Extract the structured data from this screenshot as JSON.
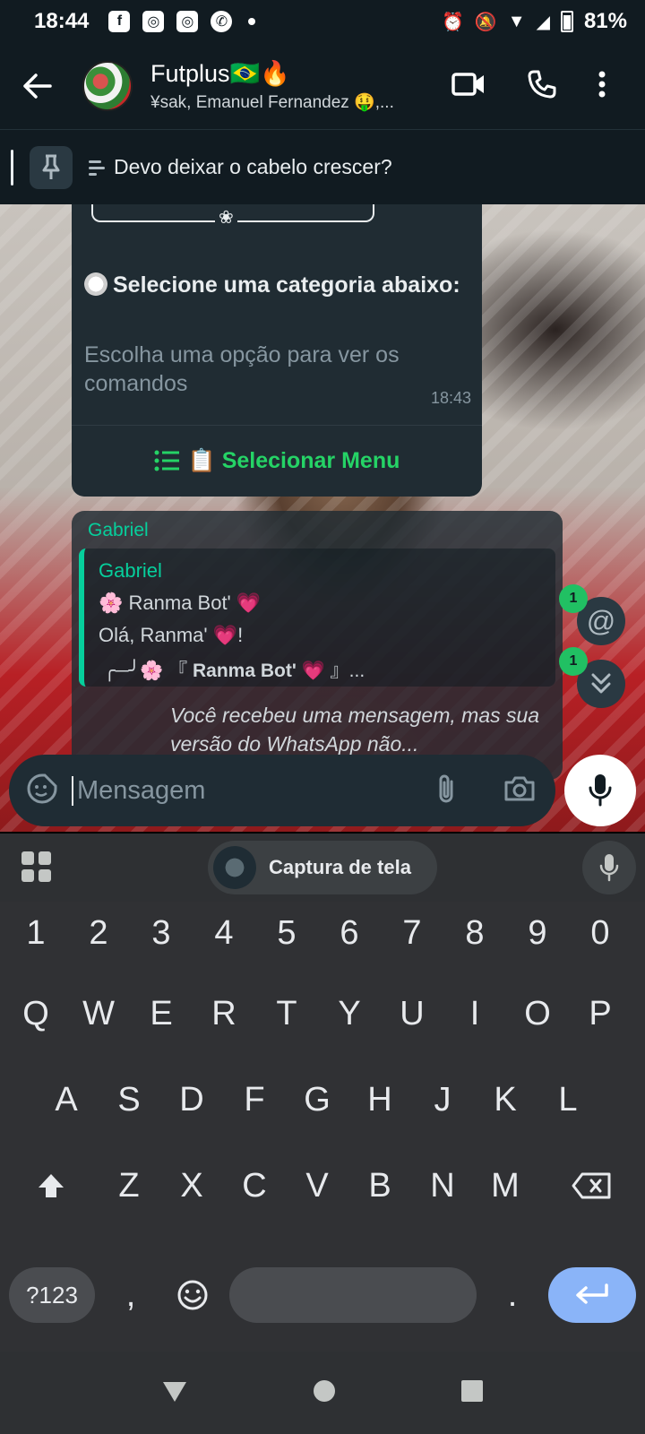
{
  "status_bar": {
    "time": "18:44",
    "battery": "81%",
    "left_icons": [
      "facebook-icon",
      "instagram-icon",
      "instagram-icon",
      "whatsapp-icon"
    ],
    "right_icons": [
      "alarm-icon",
      "mute-icon",
      "wifi-icon",
      "signal-icon",
      "battery-icon"
    ]
  },
  "header": {
    "title": "Futplus🇧🇷🔥",
    "subtitle": "¥sak, Emanuel Fernandez 🤑,..."
  },
  "pinned": {
    "text": "Devo deixar o cabelo crescer?"
  },
  "messages": {
    "menu": {
      "title": "Selecione uma categoria abaixo:",
      "description": "Escolha uma opção para ver os comandos",
      "time": "18:43",
      "button_label": "📋 Selecionar Menu"
    },
    "reply": {
      "sender": "Gabriel",
      "quoted_name": "Gabriel",
      "quoted_line1": "🌸 Ranma Bot' 💗",
      "quoted_line2": "Olá, Ranma' 💗!",
      "quoted_line3_prefix": "╭─╯🌸 『",
      "quoted_line3_bold": "Ranma Bot' 💗",
      "quoted_line3_suffix": "』...",
      "unsupported_text": "Você recebeu uma mensagem, mas sua versão do WhatsApp não..."
    }
  },
  "badges": {
    "mentions": "1",
    "unread": "1"
  },
  "composer": {
    "placeholder": "Mensagem"
  },
  "keyboard": {
    "suggestion_chip": "Captura de tela",
    "number_row": [
      "1",
      "2",
      "3",
      "4",
      "5",
      "6",
      "7",
      "8",
      "9",
      "0"
    ],
    "row1": [
      "Q",
      "W",
      "E",
      "R",
      "T",
      "Y",
      "U",
      "I",
      "O",
      "P"
    ],
    "row2": [
      "A",
      "S",
      "D",
      "F",
      "G",
      "H",
      "J",
      "K",
      "L"
    ],
    "row3": [
      "Z",
      "X",
      "C",
      "V",
      "B",
      "N",
      "M"
    ],
    "symbols_key": "?123",
    "comma": ",",
    "period": "."
  },
  "colors": {
    "accent": "#25d366",
    "bubble": "#202c33",
    "header_bg": "#111b21",
    "enter_key": "#8ab4f8"
  }
}
